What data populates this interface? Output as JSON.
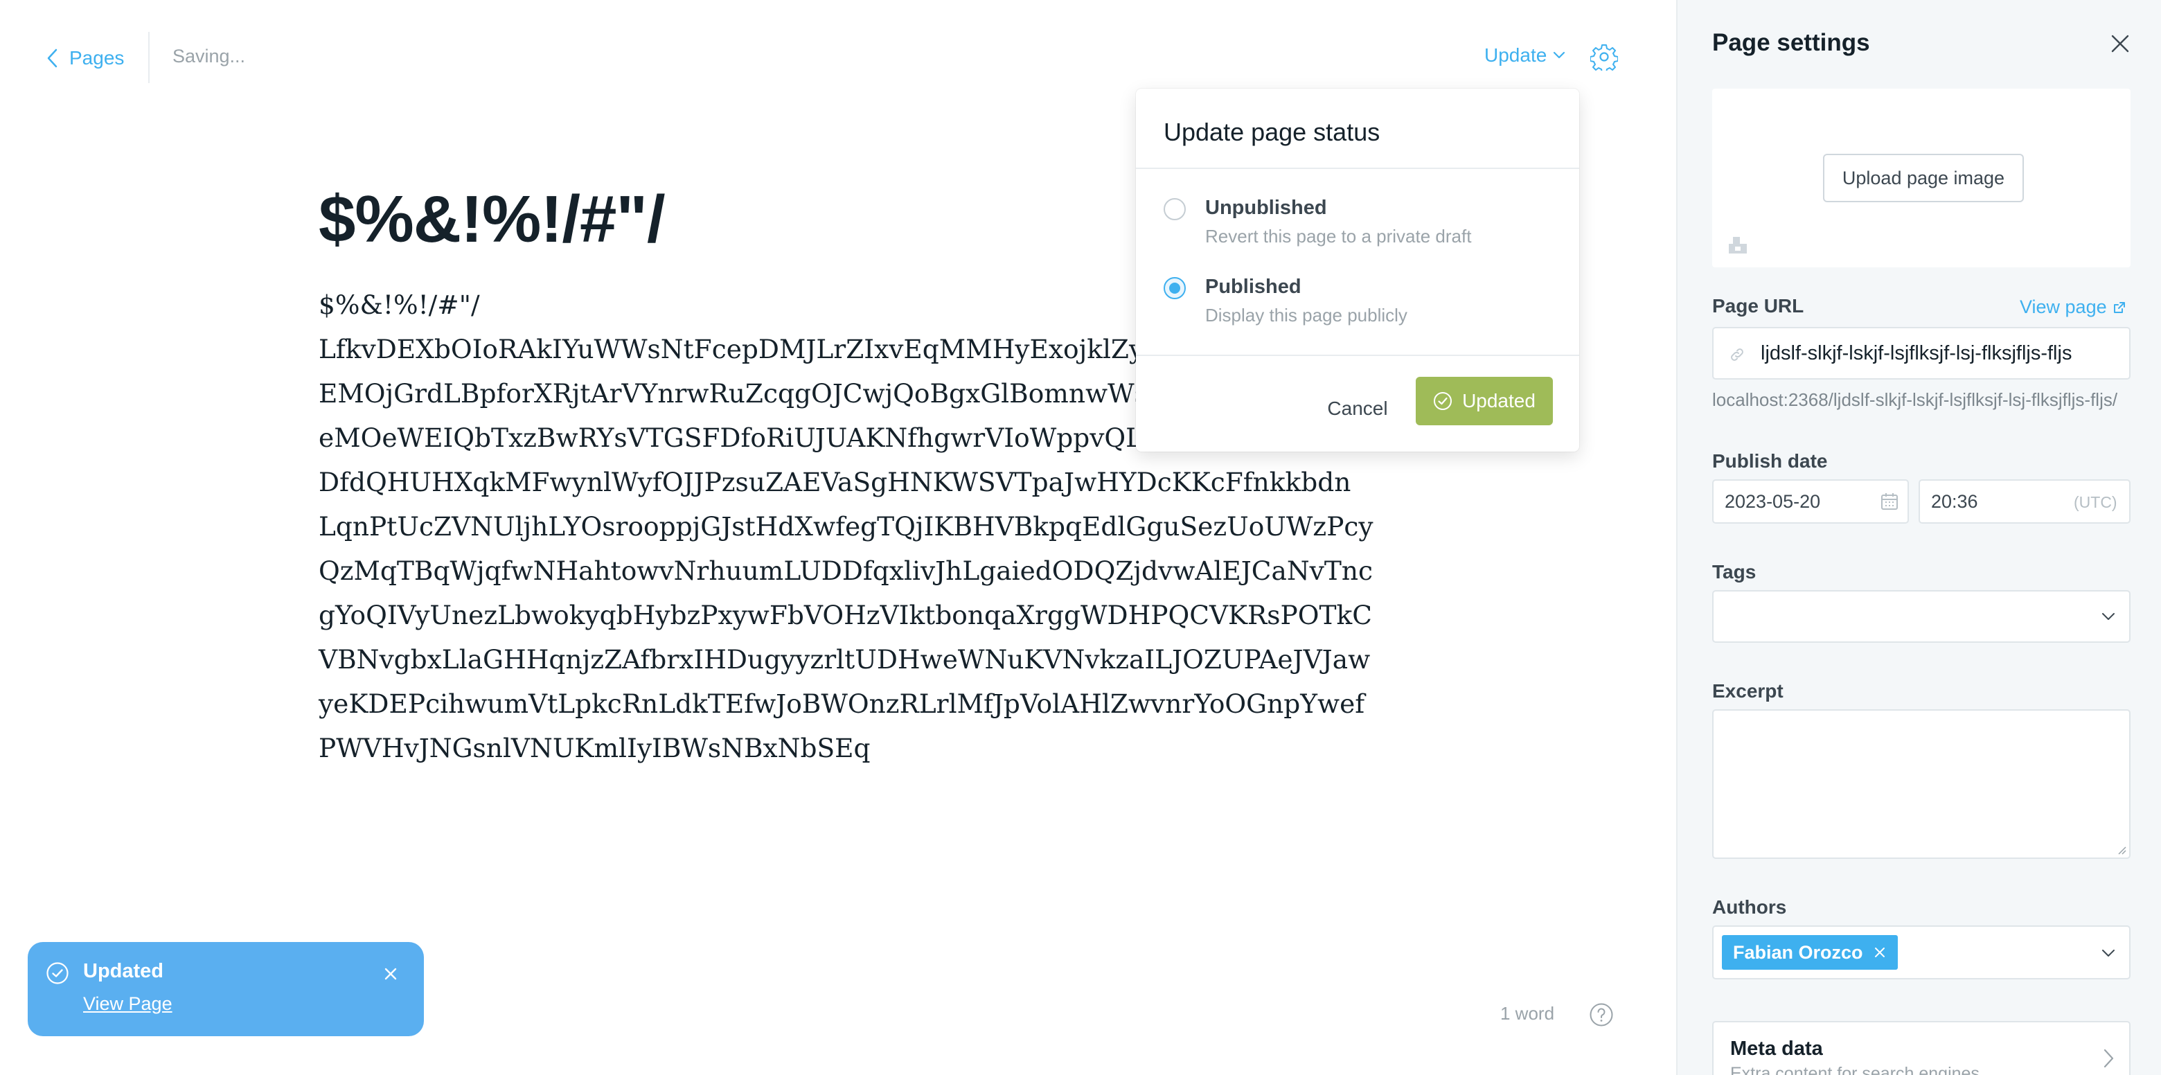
{
  "topbar": {
    "back_label": "Pages",
    "save_status": "Saving...",
    "update_label": "Update"
  },
  "editor": {
    "title": "$%&!%!/#\"/",
    "body_lines": [
      "$%&!%!/#\"/",
      "LfkvDEXbOIoRAkIYuWWsNtFcepDMJLrZIxvEqMMHyExojklZyI",
      "EMOjGrdLBpforXRjtArVYnrwRuZcqgOJCwjQoBgxGlBomnwWsb",
      "eMOeWEIQbTxzBwRYsVTGSFDfoRiUJUAKNfhgwrVIoWppvQLZ",
      "DfdQHUHXqkMFwynlWyfOJJPzsuZAEVaSgHNKWSVTpaJwHYDcKKcFfnkkbdn",
      "LqnPtUcZVNUljhLYOsrooppjGJstHdXwfegTQjIKBHVBkpqEdlGguSezUoUWzPcy",
      "QzMqTBqWjqfwNHahtowvNrhuumLUDDfqxlivJhLgaiedODQZjdvwAlEJCaNvTnc",
      "gYoQIVyUnezLbwokyqbHybzPxywFbVOHzVIktbonqaXrggWDHPQCVKRsPOTkC",
      "VBNvgbxLlaGHHqnjzZAfbrxIHDugyyzrltUDHweWNuKVNvkzaILJOZUPAeJVJaw",
      "yeKDEPcihwumVtLpkcRnLdkTEfwJoBWOnzRLrlMfJpVolAHlZwvnrYoOGnpYwef",
      "PWVHvJNGsnlVNUKmlIyIBWsNBxNbSEq"
    ],
    "word_count": "1 word"
  },
  "status_popover": {
    "title": "Update page status",
    "options": [
      {
        "label": "Unpublished",
        "description": "Revert this page to a private draft",
        "selected": false
      },
      {
        "label": "Published",
        "description": "Display this page publicly",
        "selected": true
      }
    ],
    "cancel_label": "Cancel",
    "confirm_label": "Updated"
  },
  "toast": {
    "title": "Updated",
    "link_label": "View Page"
  },
  "settings": {
    "title": "Page settings",
    "upload_label": "Upload page image",
    "url_label": "Page URL",
    "view_page_label": "View page",
    "url_value": "ljdslf-slkjf-lskjf-lsjflksjf-lsj-flksjfljs-fljs",
    "url_preview": "localhost:2368/ljdslf-slkjf-lskjf-lsjflksjf-lsj-flksjfljs-fljs/",
    "publish_date_label": "Publish date",
    "date_value": "2023-05-20",
    "time_value": "20:36",
    "timezone": "(UTC)",
    "tags_label": "Tags",
    "excerpt_label": "Excerpt",
    "authors_label": "Authors",
    "author_name": "Fabian Orozco",
    "meta_title": "Meta data",
    "meta_desc": "Extra content for search engines"
  },
  "colors": {
    "accent": "#3eb0ef",
    "success": "#9fbb58",
    "toast": "#5aaff0",
    "panel_bg": "#f4f7f9"
  },
  "icons": [
    "chevron-left-icon",
    "chevron-down-icon",
    "gear-icon",
    "check-circle-icon",
    "close-icon",
    "link-icon",
    "external-link-icon",
    "calendar-icon",
    "image-icon",
    "help-icon",
    "chevron-right-icon"
  ]
}
